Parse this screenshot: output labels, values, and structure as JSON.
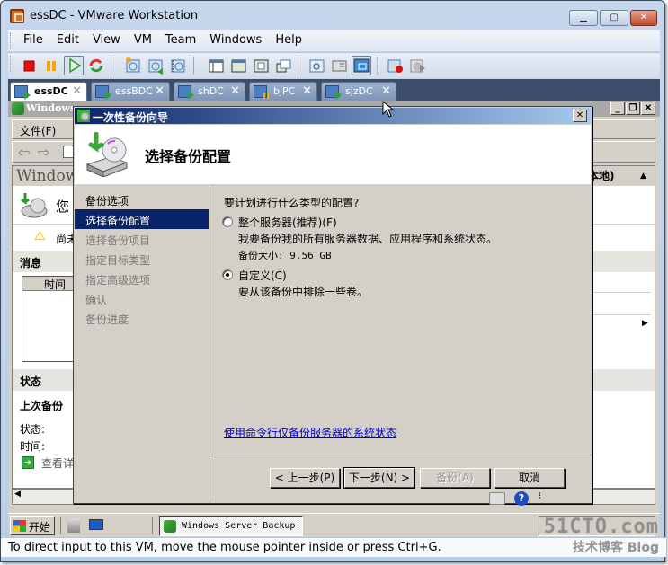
{
  "window": {
    "title": "essDC - VMware Workstation",
    "controls": {
      "minimize": "▁",
      "maximize": "▢",
      "close": "✕"
    }
  },
  "menubar": {
    "items": [
      "File",
      "Edit",
      "View",
      "VM",
      "Team",
      "Windows",
      "Help"
    ]
  },
  "toolbar": {
    "buttons": [
      "power-off",
      "suspend",
      "power-on",
      "reset",
      "take-snapshot",
      "revert-snapshot",
      "snapshot-manager",
      "show-console-view",
      "full-screen",
      "quick-switch",
      "unity",
      "vm-settings",
      "summary-view",
      "console-view",
      "record",
      "replay"
    ],
    "active": "power-on"
  },
  "tabs": [
    {
      "label": "essDC",
      "state": "running",
      "selected": true
    },
    {
      "label": "essBDC",
      "state": "running",
      "selected": false
    },
    {
      "label": "shDC",
      "state": "running",
      "selected": false
    },
    {
      "label": "bjPC",
      "state": "paused",
      "selected": false
    },
    {
      "label": "sjzDC",
      "state": "running",
      "selected": false
    }
  ],
  "guest": {
    "mmc": {
      "title": "Windows Server Backup",
      "title_truncated": "Windows",
      "menu_file": "文件(F)",
      "pane_header": "Window",
      "pane_header_right": "本地)",
      "welcome_partial": "您",
      "warning_partial": "尚未",
      "messages_section": "消息",
      "messages_column": "时间",
      "status_section": "状态",
      "last_backup_label": "上次备份",
      "status_label": "状态:",
      "time_label": "时间:",
      "view_details_partial": "查看详"
    },
    "taskbar": {
      "start_label": "开始",
      "task_item": "Windows Server Backup"
    }
  },
  "wizard": {
    "title": "一次性备份向导",
    "header": "选择备份配置",
    "steps": [
      {
        "label": "备份选项",
        "state": "done"
      },
      {
        "label": "选择备份配置",
        "state": "current"
      },
      {
        "label": "选择备份项目",
        "state": "pending"
      },
      {
        "label": "指定目标类型",
        "state": "pending"
      },
      {
        "label": "指定高级选项",
        "state": "pending"
      },
      {
        "label": "确认",
        "state": "pending"
      },
      {
        "label": "备份进度",
        "state": "pending"
      }
    ],
    "question": "要计划进行什么类型的配置?",
    "options": [
      {
        "label": "整个服务器(推荐)(F)",
        "description": "我要备份我的所有服务器数据、应用程序和系统状态。",
        "size": "备份大小: 9.56 GB",
        "selected": false
      },
      {
        "label": "自定义(C)",
        "description": "要从该备份中排除一些卷。",
        "selected": true
      }
    ],
    "link": "使用命令行仅备份服务器的系统状态",
    "buttons": {
      "back": "< 上一步(P)",
      "next": "下一步(N) >",
      "backup": "备份(A)",
      "cancel": "取消"
    }
  },
  "statusbar": {
    "message": "To direct input to this VM, move the mouse pointer inside or press Ctrl+G."
  },
  "watermark": {
    "line1": "51CTO.com",
    "line2": "技术博客 Blog"
  }
}
